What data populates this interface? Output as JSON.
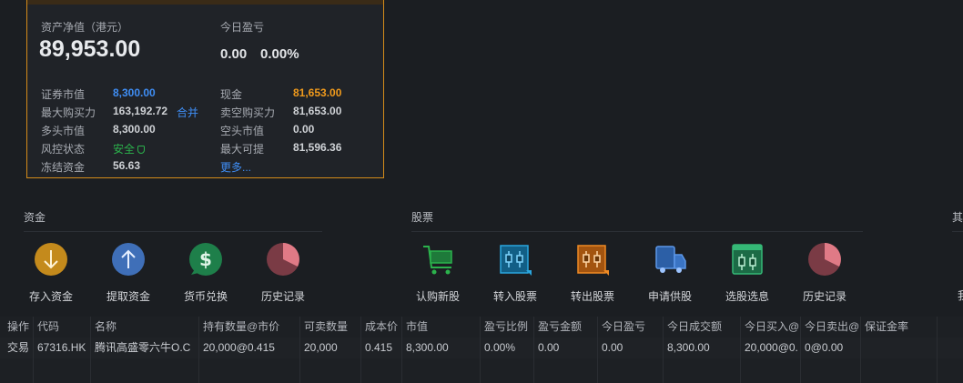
{
  "account": {
    "net_asset_label": "资产净值（港元）",
    "net_asset_value": "89,953.00",
    "today_pl_label": "今日盈亏",
    "today_pl_amount": "0.00",
    "today_pl_pct": "0.00%",
    "left": [
      {
        "label": "证券市值",
        "value": "8,300.00"
      },
      {
        "label": "最大购买力",
        "value": "163,192.72",
        "link": "合并"
      },
      {
        "label": "多头市值",
        "value": "8,300.00"
      },
      {
        "label": "风控状态",
        "value": "安全"
      },
      {
        "label": "冻结资金",
        "value": "56.63"
      }
    ],
    "right": [
      {
        "label": "现金",
        "value": "81,653.00"
      },
      {
        "label": "卖空购买力",
        "value": "81,653.00"
      },
      {
        "label": "空头市值",
        "value": "0.00"
      },
      {
        "label": "最大可提",
        "value": "81,596.36"
      },
      {
        "label": "",
        "value": "更多..."
      }
    ]
  },
  "sections": {
    "funds": {
      "title": "资金",
      "items": [
        "存入资金",
        "提取资金",
        "货币兑换",
        "历史记录"
      ]
    },
    "stocks": {
      "title": "股票",
      "items": [
        "认购新股",
        "转入股票",
        "转出股票",
        "申请供股",
        "选股选息",
        "历史记录"
      ]
    },
    "other": {
      "title": "其",
      "item_fragment": "我"
    }
  },
  "table": {
    "headers": [
      "操作",
      "代码",
      "名称",
      "持有数量@市价",
      "可卖数量",
      "成本价",
      "市值",
      "盈亏比例",
      "盈亏金额",
      "今日盈亏",
      "今日成交额",
      "今日买入@",
      "今日卖出@",
      "保证金率"
    ],
    "rows": [
      [
        "交易",
        "67316.HK",
        "腾讯高盛零六牛O.C",
        "20,000@0.415",
        "20,000",
        "0.415",
        "8,300.00",
        "0.00%",
        "0.00",
        "0.00",
        "8,300.00",
        "20,000@0.",
        "0@0.00",
        ""
      ]
    ]
  },
  "colors": {
    "accent_blue": "#3f8ef5",
    "accent_orange": "#f09a1c",
    "safe_green": "#2bb24c",
    "card_border": "#d48b1a"
  }
}
